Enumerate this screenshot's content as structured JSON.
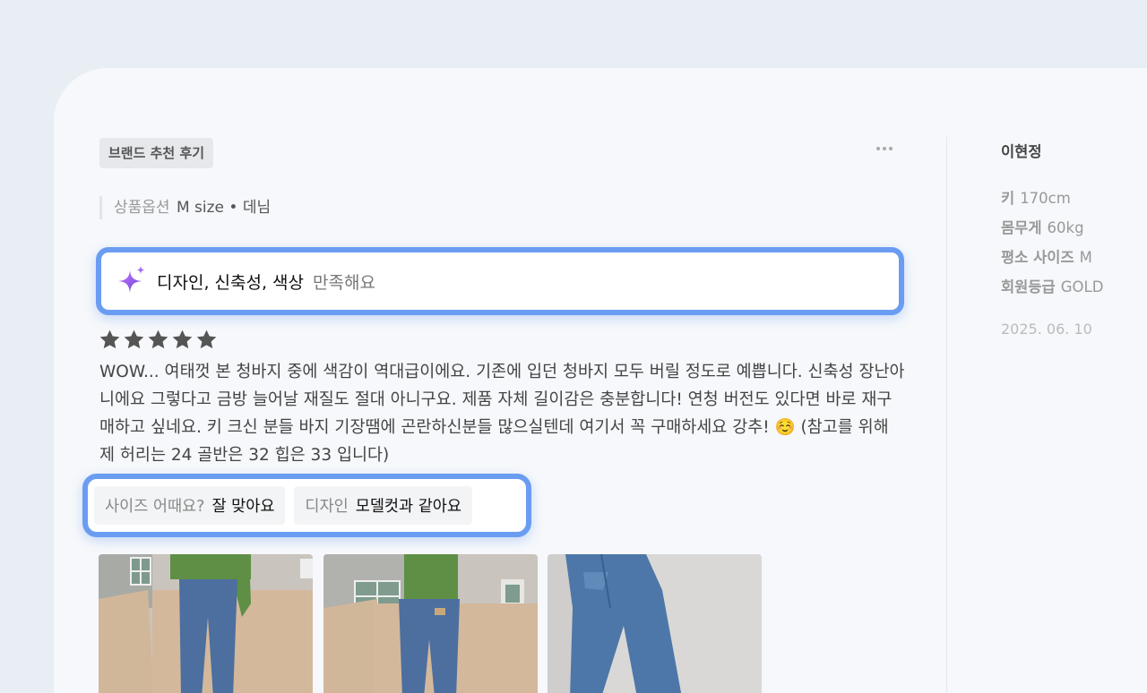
{
  "review": {
    "badge": "브랜드 추천 후기",
    "option_label": "상품옵션",
    "option_value": "M size • 데님",
    "ai_summary_strong": "디자인, 신축성, 색상",
    "ai_summary_weak": "만족해요",
    "rating": 5,
    "rating_max": 5,
    "text": "WOW... 여태껏 본 청바지 중에 색감이 역대급이에요. 기존에 입던 청바지 모두 버릴 정도로 예쁩니다. 신축성 장난아니에요 그렇다고 금방 늘어날 재질도 절대 아니구요. 제품 자체 길이감은 충분합니다! 연청 버전도 있다면 바로 재구매하고 싶네요. 키 크신 분들 바지 기장땜에 곤란하신분들 많으실텐데 여기서 꼭 구매하세요 강추! ☺️ (참고를 위해 제 허리는 24 골반은 32 힙은 33 입니다)",
    "tags": [
      {
        "question": "사이즈 어때요?",
        "answer": "잘 맞아요"
      },
      {
        "question": "디자인",
        "answer": "모델컷과 같아요"
      }
    ]
  },
  "reviewer": {
    "name": "이현정",
    "height_label": "키",
    "height_value": "170cm",
    "weight_label": "몸무게",
    "weight_value": "60kg",
    "size_label": "평소 사이즈",
    "size_value": "M",
    "grade_label": "회원등급",
    "grade_value": "GOLD",
    "date": "2025. 06. 10"
  },
  "colors": {
    "accent_border": "#6a9cf2",
    "star": "#555555",
    "spark_purple": "#9b59e8"
  },
  "icons": [
    "more-icon",
    "sparkle-icon",
    "star-icon"
  ]
}
